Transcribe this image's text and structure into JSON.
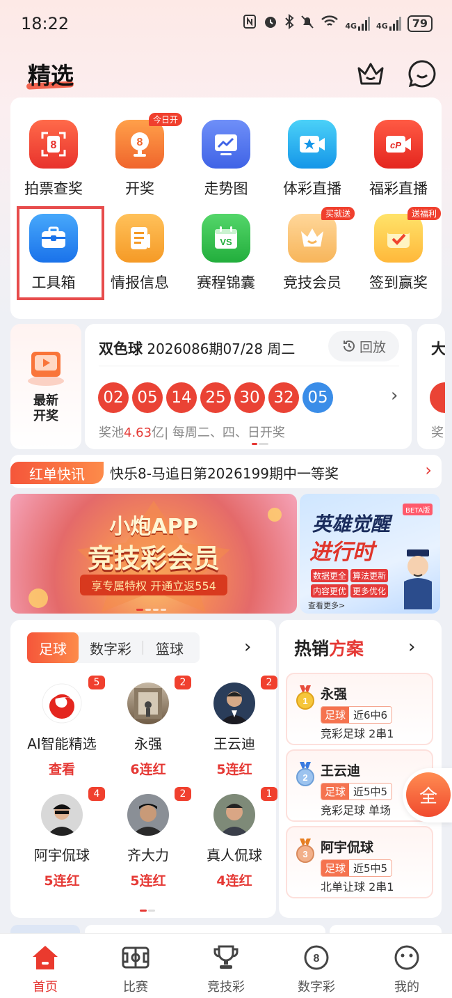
{
  "status_bar": {
    "time": "18:22",
    "signal1": "4G",
    "signal2": "4G",
    "battery": "79"
  },
  "header": {
    "title": "精选"
  },
  "grid": [
    {
      "label": "拍票查奖",
      "badge": ""
    },
    {
      "label": "开奖",
      "badge": "今日开"
    },
    {
      "label": "走势图",
      "badge": ""
    },
    {
      "label": "体彩直播",
      "badge": ""
    },
    {
      "label": "福彩直播",
      "badge": ""
    },
    {
      "label": "工具箱",
      "badge": ""
    },
    {
      "label": "情报信息",
      "badge": ""
    },
    {
      "label": "赛程锦囊",
      "badge": ""
    },
    {
      "label": "竞技会员",
      "badge": "买就送"
    },
    {
      "label": "签到赢奖",
      "badge": "送福利"
    }
  ],
  "news_left": {
    "line1": "最新",
    "line2": "开奖"
  },
  "draw": {
    "name": "双色球",
    "issue": "2026086期",
    "date": "07/28 周二",
    "replay": "回放",
    "red_balls": [
      "02",
      "05",
      "14",
      "25",
      "30",
      "32"
    ],
    "blue_balls": [
      "05"
    ],
    "pool_label": "奖池",
    "pool_amount": "4.63",
    "pool_unit": "亿",
    "schedule": "| 每周二、四、日开奖"
  },
  "draw_peek": {
    "text": "大",
    "pool": "奖"
  },
  "ticker": {
    "tag": "红单快讯",
    "text": "快乐8-马追日第2026199期中一等奖"
  },
  "banner_left": {
    "line1": "小炮APP",
    "line2": "竞技彩会员",
    "sub": "享专属特权 开通立返554"
  },
  "banner_right": {
    "line1": "英雄觉醒",
    "line2": "进行时",
    "beta": "BETA版",
    "tags": [
      "数据更全",
      "算法更新",
      "内容更优",
      "更多优化"
    ],
    "more": "查看更多>"
  },
  "experts": {
    "tabs": [
      "足球",
      "数字彩",
      "篮球"
    ],
    "items": [
      {
        "name": "AI智能精选",
        "streak": "查看",
        "badge": "5"
      },
      {
        "name": "永强",
        "streak": "6连红",
        "badge": "2"
      },
      {
        "name": "王云迪",
        "streak": "5连红",
        "badge": "2"
      },
      {
        "name": "阿宇侃球",
        "streak": "5连红",
        "badge": "4"
      },
      {
        "name": "齐大力",
        "streak": "5连红",
        "badge": "2"
      },
      {
        "name": "真人侃球",
        "streak": "4连红",
        "badge": "1"
      }
    ]
  },
  "hot": {
    "title_a": "热销",
    "title_b": "方案",
    "items": [
      {
        "name": "永强",
        "tag": "足球",
        "record": "近6中6",
        "desc": "竞彩足球 2串1"
      },
      {
        "name": "王云迪",
        "tag": "足球",
        "record": "近5中5",
        "desc": "竞彩足球 单场"
      },
      {
        "name": "阿宇侃球",
        "tag": "足球",
        "record": "近5中5",
        "desc": "北单让球 2串1"
      }
    ]
  },
  "float_button": {
    "label": "全"
  },
  "nav": [
    {
      "label": "首页"
    },
    {
      "label": "比赛"
    },
    {
      "label": "竞技彩"
    },
    {
      "label": "数字彩"
    },
    {
      "label": "我的"
    }
  ],
  "colors": {
    "accent": "#e53935",
    "ball_red": "#ea4335",
    "ball_blue": "#3a8de8"
  }
}
